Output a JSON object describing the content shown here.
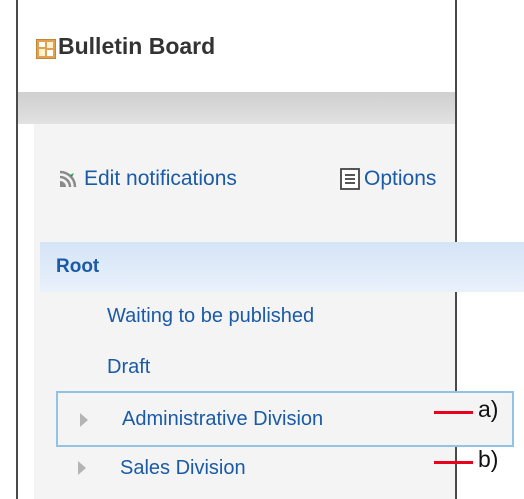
{
  "app": {
    "title": "Bulletin Board",
    "icon": "bulletin-board-icon"
  },
  "toolbar": {
    "edit_notifications": "Edit notifications",
    "edit_notifications_icon": "rss-feed-icon",
    "options": "Options",
    "options_icon": "list-icon"
  },
  "tree": {
    "root": "Root",
    "waiting": "Waiting to be published",
    "draft": "Draft",
    "admin": "Administrative Division",
    "sales": "Sales Division",
    "expand_icon": "expand-triangle-icon"
  },
  "callouts": {
    "a": "a)",
    "b": "b)",
    "color": "#e8001c"
  },
  "colors": {
    "link": "#1a5aa6",
    "root_highlight": "#d5e4f7",
    "selection_border": "#90c3e6"
  }
}
